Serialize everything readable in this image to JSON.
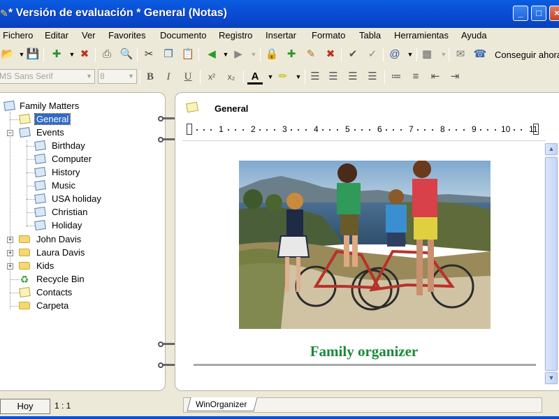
{
  "window": {
    "title": "* Versión de evaluación * General (Notas)"
  },
  "menu": [
    "Fichero",
    "Editar",
    "Ver",
    "Favorites",
    "Documento",
    "Registro",
    "Insertar",
    "Formato",
    "Tabla",
    "Herramientas",
    "Ayuda"
  ],
  "toolbar": {
    "conseguir_label": "Conseguir ahora",
    "font_name": "MS Sans Serif",
    "font_size": "8"
  },
  "tree": {
    "root": "Family Matters",
    "general": "General",
    "events": "Events",
    "event_items": [
      "Birthday",
      "Computer",
      "History",
      "Music",
      "USA holiday",
      "Christian",
      "Holiday"
    ],
    "folders": [
      "John Davis",
      "Laura Davis",
      "Kids"
    ],
    "recycle": "Recycle Bin",
    "contacts": "Contacts",
    "carpeta": "Carpeta"
  },
  "note": {
    "title": "General",
    "caption": "Family organizer"
  },
  "ruler": [
    "1",
    "2",
    "3",
    "4",
    "5",
    "6",
    "7",
    "8",
    "9",
    "10",
    "11"
  ],
  "bottom": {
    "hoy_label": "Hoy",
    "counter": "1 : 1",
    "tab_label": "WinOrganizer"
  },
  "colors": {
    "title_bar": "#0a4fd6",
    "selection": "#316ac5",
    "caption": "#1a8a3a"
  }
}
